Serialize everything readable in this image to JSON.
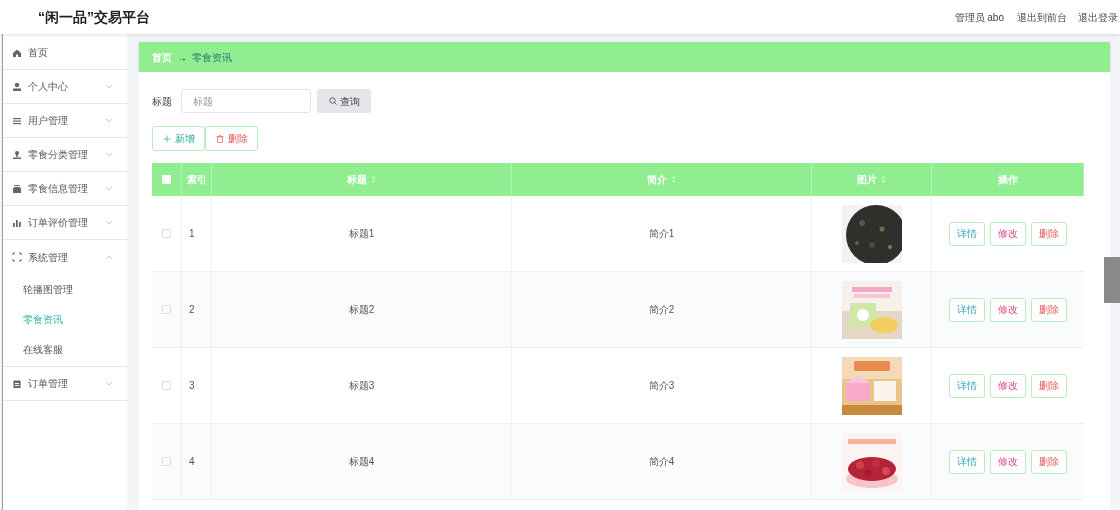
{
  "header": {
    "title": "“闲一品”交易平台",
    "user": "管理员 abo",
    "links": [
      "退出到前台",
      "退出登录"
    ]
  },
  "sidebar": {
    "items": [
      {
        "label": "首页"
      },
      {
        "label": "个人中心",
        "expanded": false
      },
      {
        "label": "用户管理",
        "expanded": false
      },
      {
        "label": "零食分类管理",
        "expanded": false
      },
      {
        "label": "零食信息管理",
        "expanded": false
      },
      {
        "label": "订单评价管理",
        "expanded": false
      },
      {
        "label": "系统管理",
        "expanded": true,
        "children": [
          {
            "label": "轮播图管理",
            "selected": false
          },
          {
            "label": "零食资讯",
            "selected": true
          },
          {
            "label": "在线客服",
            "selected": false
          }
        ]
      },
      {
        "label": "订单管理",
        "expanded": false
      }
    ]
  },
  "breadcrumb": {
    "items": [
      "首页",
      "零食资讯"
    ],
    "separator": "→"
  },
  "search": {
    "label": "标题",
    "placeholder": "标题",
    "button": "查询"
  },
  "toolbar": [
    {
      "label": "新增",
      "kind": "add"
    },
    {
      "label": "删除",
      "kind": "delete"
    }
  ],
  "table": {
    "select_all_checked": false,
    "columns": [
      {
        "label": "索引"
      },
      {
        "label": "标题",
        "sortable": true
      },
      {
        "label": "简介",
        "sortable": true
      },
      {
        "label": "图片",
        "sortable": true
      },
      {
        "label": "操作"
      }
    ],
    "rows": [
      {
        "checked": false,
        "index": "1",
        "title": "标题1",
        "intro": "简介1",
        "image": {
          "kind": "picture"
        },
        "actions": [
          "详情",
          "修改",
          "删除"
        ]
      },
      {
        "checked": false,
        "index": "2",
        "title": "标题2",
        "intro": "简介2",
        "image": {
          "kind": "picture"
        },
        "actions": [
          "详情",
          "修改",
          "删除"
        ]
      },
      {
        "checked": false,
        "index": "3",
        "title": "标题3",
        "intro": "简介3",
        "image": {
          "kind": "picture"
        },
        "actions": [
          "详情",
          "修改",
          "删除"
        ]
      },
      {
        "checked": false,
        "index": "4",
        "title": "标题4",
        "intro": "简介4",
        "image": {
          "kind": "picture"
        },
        "actions": [
          "详情",
          "修改",
          "删除"
        ]
      }
    ]
  }
}
